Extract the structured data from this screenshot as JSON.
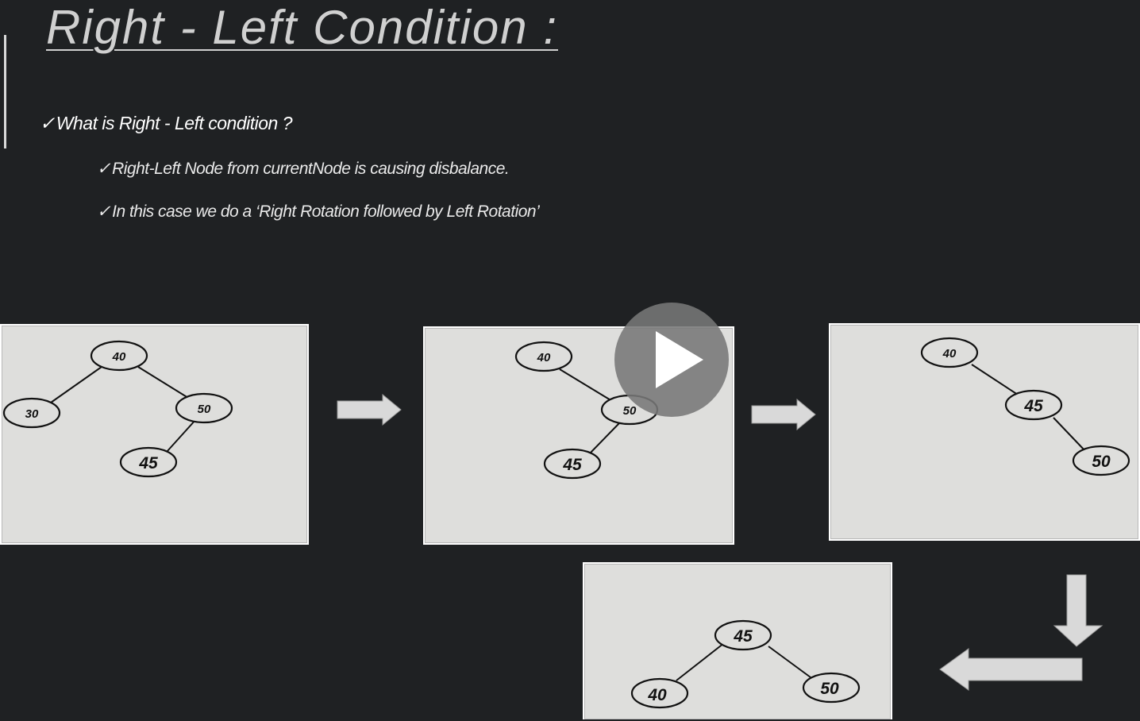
{
  "slide": {
    "title": "Right - Left Condition :",
    "bullet_main": "What is Right - Left condition ?",
    "bullet_sub_1": "Right-Left Node from currentNode is causing disbalance.",
    "bullet_sub_2": "In this case we do a ‘Right Rotation followed by Left Rotation’",
    "check_glyph": "✓"
  },
  "diagrams": {
    "step1": {
      "root": "40",
      "left": "30",
      "right": "50",
      "right_left": "45"
    },
    "step2": {
      "root": "40",
      "right": "50",
      "right_left": "45"
    },
    "step3": {
      "root": "40",
      "right": "45",
      "right_right": "50"
    },
    "step4": {
      "root": "45",
      "left": "40",
      "right": "50"
    }
  },
  "icons": {
    "arrows": [
      "arrow-right-icon",
      "arrow-right-icon",
      "arrow-down-left-icon"
    ],
    "player": "play-icon"
  },
  "colors": {
    "background": "#1f2123",
    "panel": "#dededc",
    "arrow": "#d9d9d9",
    "play_overlay": "#787878"
  }
}
